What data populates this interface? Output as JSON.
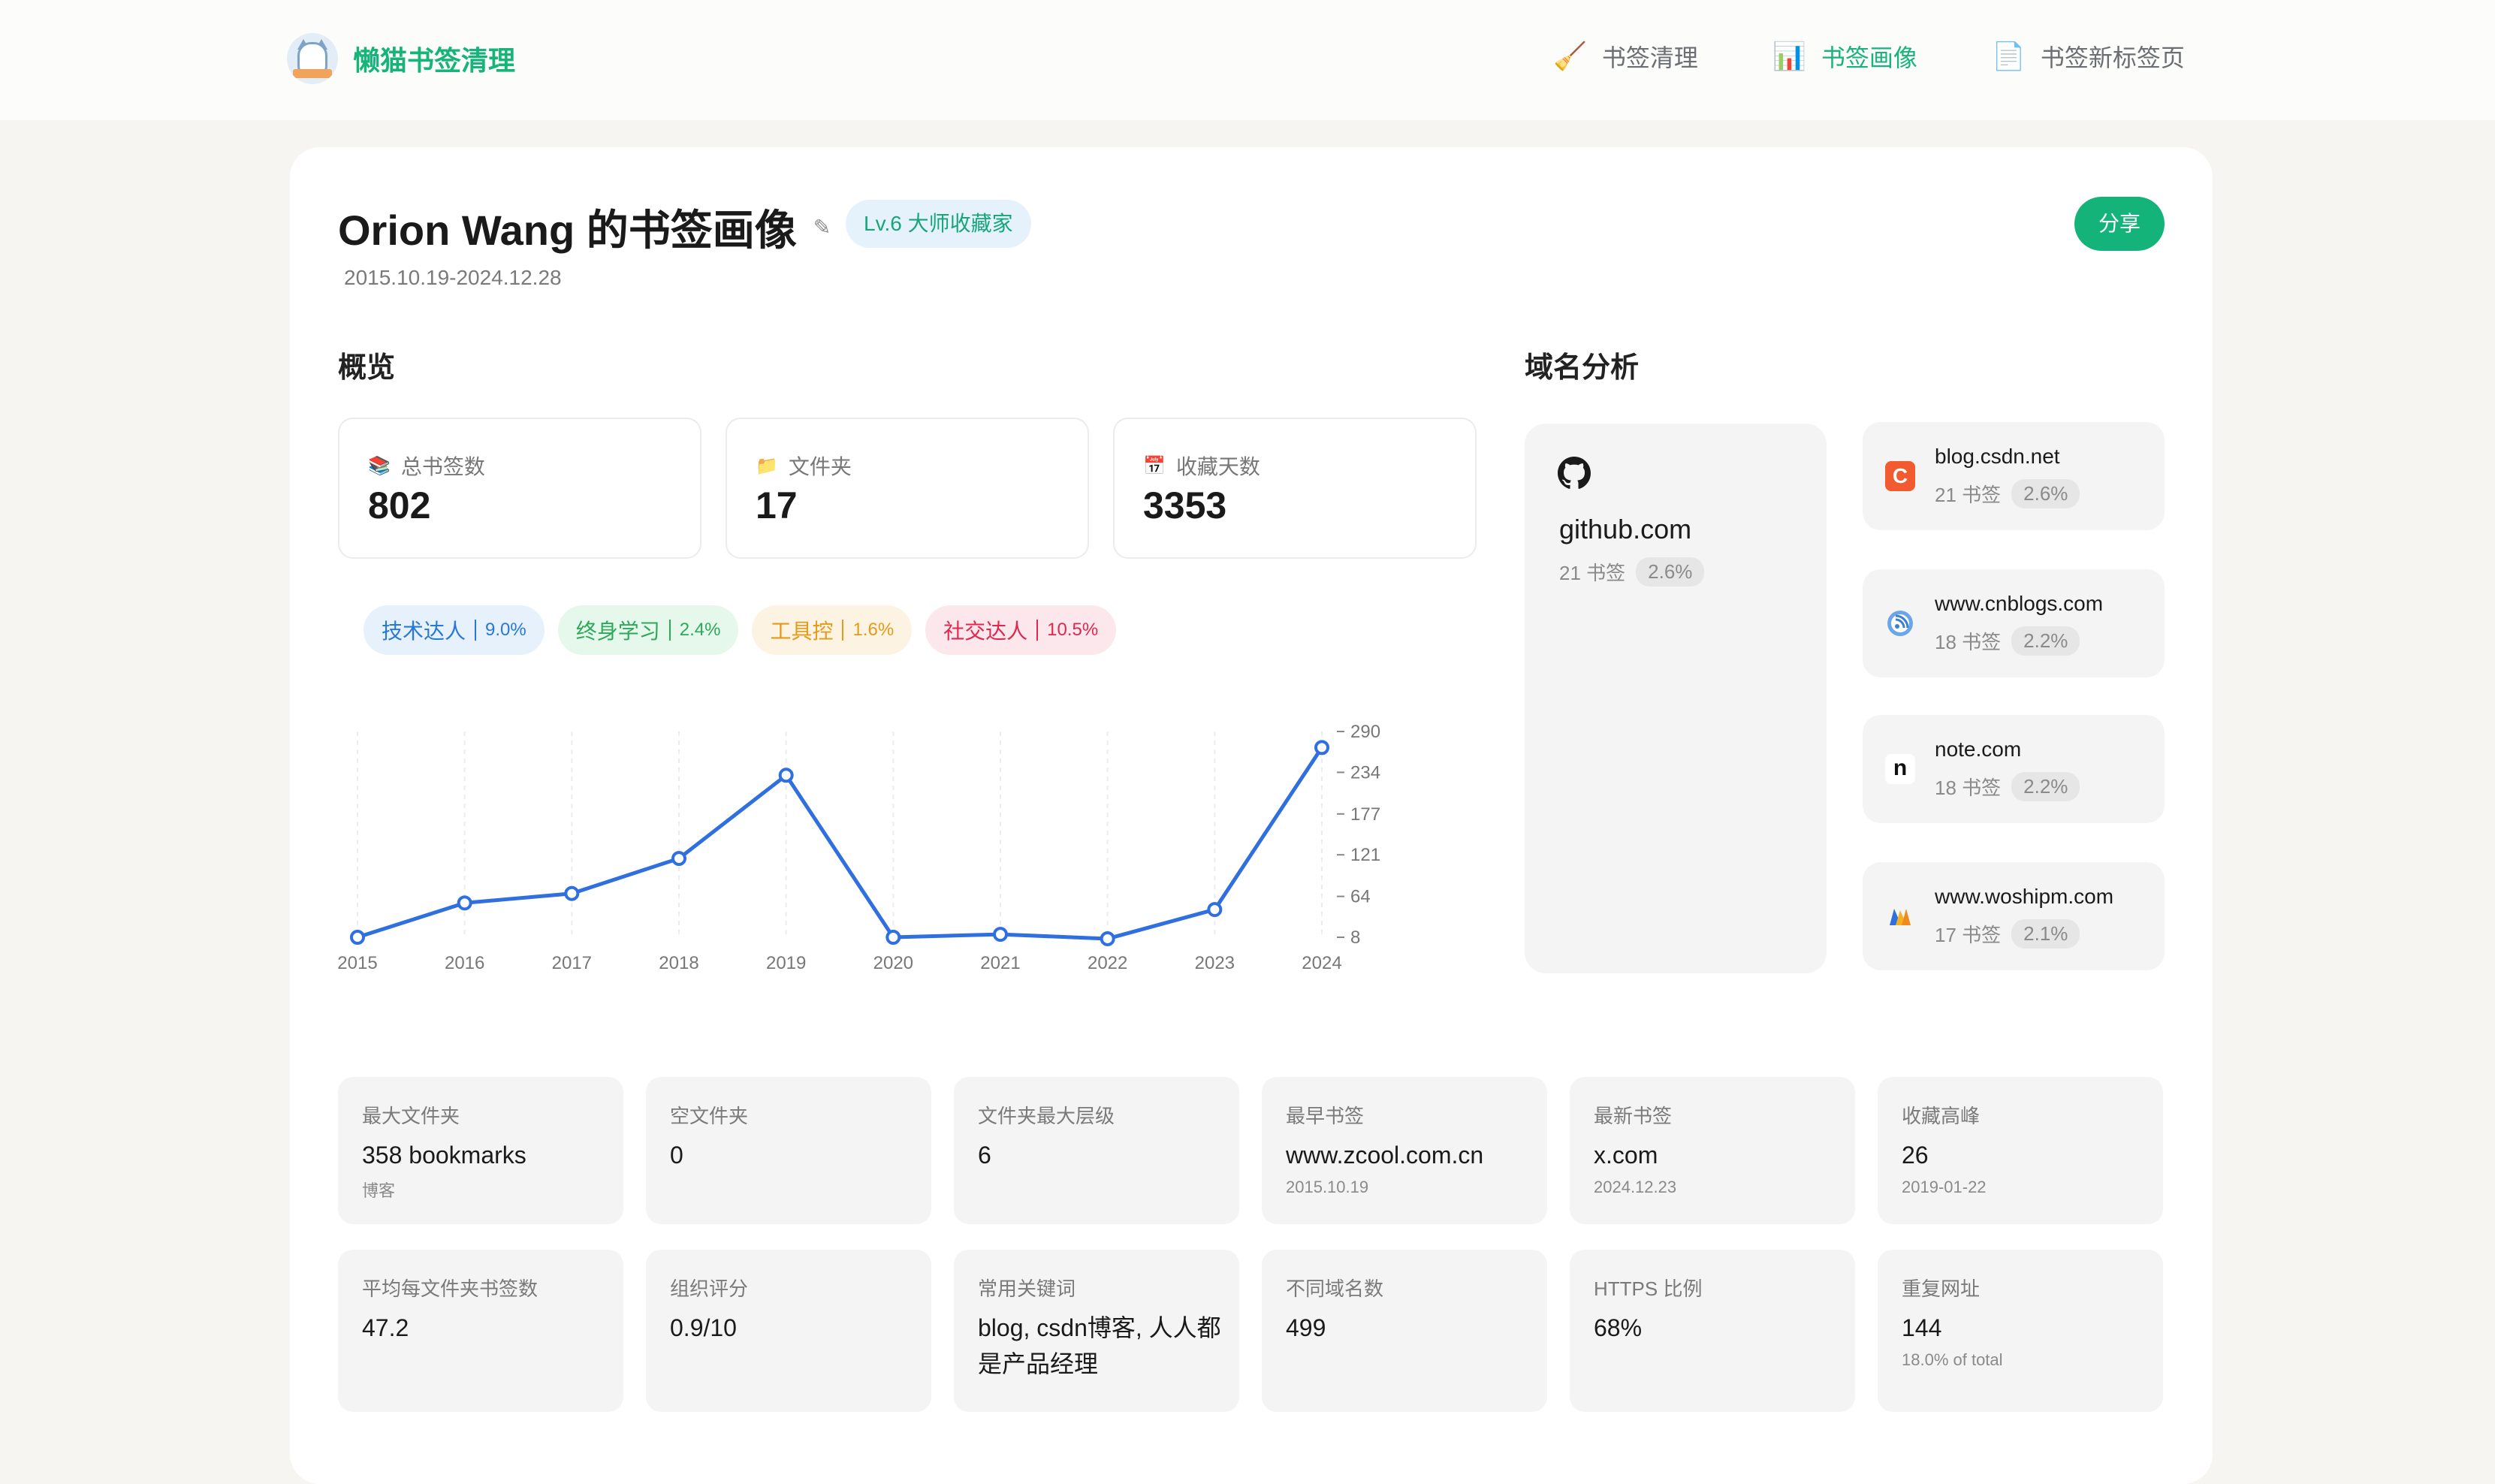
{
  "app": {
    "name": "懒猫书签清理"
  },
  "nav": [
    {
      "label": "书签清理",
      "icon": "broom-icon",
      "active": false
    },
    {
      "label": "书签画像",
      "icon": "bar-chart-icon",
      "active": true
    },
    {
      "label": "书签新标签页",
      "icon": "page-icon",
      "active": false
    }
  ],
  "profile": {
    "title": "Orion Wang 的书签画像",
    "level": "Lv.6  大师收藏家",
    "date_range": "2015.10.19-2024.12.28",
    "share_label": "分享"
  },
  "overview": {
    "title": "概览",
    "stats": [
      {
        "label": "总书签数",
        "value": "802",
        "icon": "books-icon"
      },
      {
        "label": "文件夹",
        "value": "17",
        "icon": "folder-icon"
      },
      {
        "label": "收藏天数",
        "value": "3353",
        "icon": "calendar-icon"
      }
    ],
    "tags": [
      {
        "label": "技术达人",
        "pct": "9.0%"
      },
      {
        "label": "终身学习",
        "pct": "2.4%"
      },
      {
        "label": "工具控",
        "pct": "1.6%"
      },
      {
        "label": "社交达人",
        "pct": "10.5%"
      }
    ]
  },
  "chart_data": {
    "type": "line",
    "x": [
      "2015",
      "2016",
      "2017",
      "2018",
      "2019",
      "2020",
      "2021",
      "2022",
      "2023",
      "2024"
    ],
    "values": [
      8,
      55,
      68,
      116,
      230,
      8,
      12,
      6,
      46,
      268
    ],
    "yticks": [
      "290",
      "234",
      "177",
      "121",
      "64",
      "8"
    ],
    "ylim": [
      8,
      290
    ],
    "y_axis_side": "right",
    "grid": "vertical dashed",
    "color": "#2f6fe0"
  },
  "domains": {
    "title": "域名分析",
    "top": {
      "name": "github.com",
      "count": "21 书签",
      "pct": "2.6%"
    },
    "list": [
      {
        "name": "blog.csdn.net",
        "count": "21 书签",
        "pct": "2.6%",
        "icon": "csdn-icon"
      },
      {
        "name": "www.cnblogs.com",
        "count": "18 书签",
        "pct": "2.2%",
        "icon": "cnblogs-icon"
      },
      {
        "name": "note.com",
        "count": "18 书签",
        "pct": "2.2%",
        "icon": "note-icon"
      },
      {
        "name": "www.woshipm.com",
        "count": "17 书签",
        "pct": "2.1%",
        "icon": "woshipm-icon"
      }
    ]
  },
  "details_row1": [
    {
      "label": "最大文件夹",
      "value": "358 bookmarks",
      "sub": "博客"
    },
    {
      "label": "空文件夹",
      "value": "0",
      "sub": ""
    },
    {
      "label": "文件夹最大层级",
      "value": "6",
      "sub": ""
    },
    {
      "label": "最早书签",
      "value": "www.zcool.com.cn",
      "sub": "2015.10.19"
    },
    {
      "label": "最新书签",
      "value": "x.com",
      "sub": "2024.12.23"
    },
    {
      "label": "收藏高峰",
      "value": "26",
      "sub": "2019-01-22"
    }
  ],
  "details_row2": [
    {
      "label": "平均每文件夹书签数",
      "value": "47.2",
      "sub": ""
    },
    {
      "label": "组织评分",
      "value": "0.9/10",
      "sub": ""
    },
    {
      "label": "常用关键词",
      "value": "blog, csdn博客, 人人都是产品经理",
      "sub": ""
    },
    {
      "label": "不同域名数",
      "value": "499",
      "sub": ""
    },
    {
      "label": "HTTPS 比例",
      "value": "68%",
      "sub": ""
    },
    {
      "label": "重复网址",
      "value": "144",
      "sub": "18.0% of total"
    }
  ]
}
